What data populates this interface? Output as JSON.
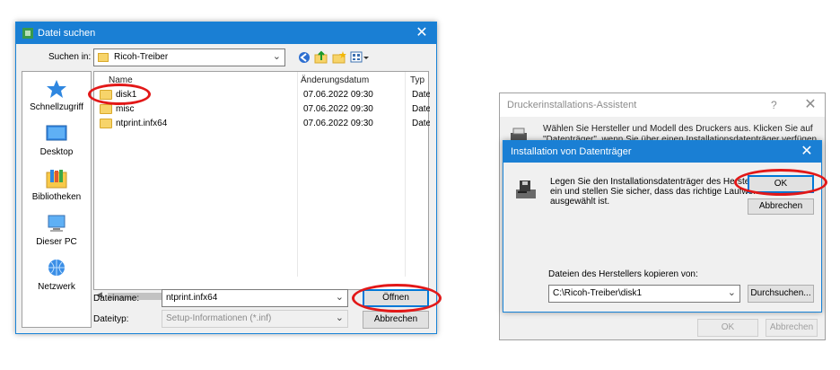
{
  "dialog1": {
    "title": "Datei suchen",
    "search_in_label": "Suchen in:",
    "search_in_value": "Ricoh-Treiber",
    "sidebar": [
      {
        "label": "Schnellzugriff",
        "icon": "star-icon"
      },
      {
        "label": "Desktop",
        "icon": "desktop-icon"
      },
      {
        "label": "Bibliotheken",
        "icon": "libraries-icon"
      },
      {
        "label": "Dieser PC",
        "icon": "computer-icon"
      },
      {
        "label": "Netzwerk",
        "icon": "network-icon"
      }
    ],
    "columns": {
      "name": "Name",
      "date": "Änderungsdatum",
      "type": "Typ"
    },
    "files": [
      {
        "name": "disk1",
        "date": "07.06.2022 09:30",
        "type": "Datei"
      },
      {
        "name": "misc",
        "date": "07.06.2022 09:30",
        "type": "Datei"
      },
      {
        "name": "ntprint.infx64",
        "date": "07.06.2022 09:30",
        "type": "Datei"
      }
    ],
    "filename_label": "Dateiname:",
    "filename_value": "ntprint.infx64",
    "filetype_label": "Dateityp:",
    "filetype_value": "Setup-Informationen (*.inf)",
    "open_button": "Öffnen",
    "cancel_button": "Abbrechen",
    "close_glyph": "✕"
  },
  "dialog2": {
    "title": "Druckerinstallations-Assistent",
    "help_glyph": "?",
    "close_glyph": "✕",
    "intro_line1": "Wählen Sie Hersteller und Modell des Druckers aus. Klicken Sie auf",
    "intro_line2": "\"Datenträger\", wenn Sie über einen Installationsdatenträger verfügen.",
    "ok_button": "OK",
    "cancel_button": "Abbrechen"
  },
  "dialog3": {
    "title": "Installation von Datenträger",
    "close_glyph": "✕",
    "message_line1": "Legen Sie den Installationsdatenträger des Herstellers",
    "message_line2": "ein und stellen Sie sicher, dass das richtige Laufwerk",
    "message_line3": "ausgewählt ist.",
    "ok_button": "OK",
    "cancel_button": "Abbrechen",
    "copy_label": "Dateien des Herstellers kopieren von:",
    "copy_value": "C:\\Ricoh-Treiber\\disk1",
    "browse_button": "Durchsuchen..."
  },
  "colors": {
    "titlebar": "#1a7fd4",
    "annotation": "#e21818",
    "folder": "#f7d46a"
  }
}
